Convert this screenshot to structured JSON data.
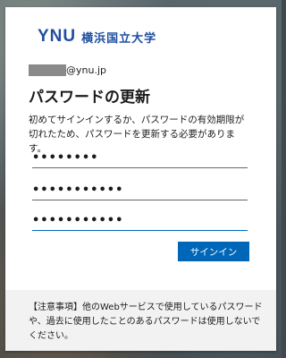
{
  "logo": {
    "en": "YNU",
    "jp": "横浜国立大学"
  },
  "account": {
    "domain": "@ynu.jp"
  },
  "title": "パスワードの更新",
  "description": "初めてサインインするか、パスワードの有効期限が切れたため、パスワードを更新する必要があります。",
  "fields": {
    "current_password": "••••••••",
    "new_password": "•••••••••••",
    "confirm_password": "•••••••••••"
  },
  "signin_button": "サインイン",
  "notice": "【注意事項】他のWebサービスで使用しているパスワードや、過去に使用したことのあるパスワードは使用しないでください。",
  "colors": {
    "brand": "#1f4fa0",
    "accent": "#0067b8",
    "notice_bg": "#f2f2f2"
  }
}
